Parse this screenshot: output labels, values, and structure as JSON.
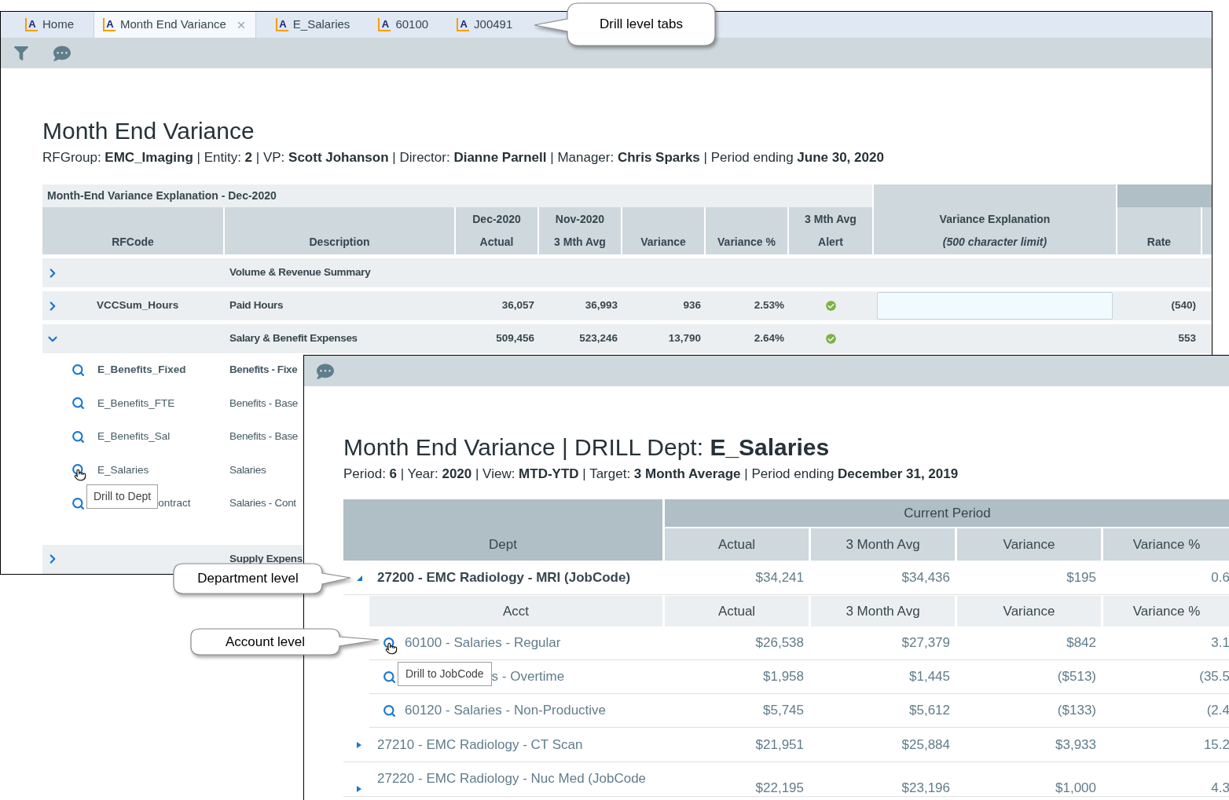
{
  "tabs": [
    {
      "badge": "A",
      "label": "Home",
      "selected": false,
      "closable": false
    },
    {
      "badge": "A",
      "label": "Month End Variance",
      "selected": true,
      "closable": true
    },
    {
      "badge": "A",
      "label": "E_Salaries",
      "selected": false,
      "closable": false
    },
    {
      "badge": "A",
      "label": "60100",
      "selected": false,
      "closable": false
    },
    {
      "badge": "A",
      "label": "J00491",
      "selected": false,
      "closable": false
    }
  ],
  "report": {
    "title": "Month End Variance",
    "subtitle": "RFGroup: **EMC_Imaging** | Entity: **2** | VP: **Scott Johanson** | Director: **Dianne Parnell** | Manager: **Chris Sparks** | Period ending **June 30, 2020**",
    "table": {
      "caption": "Month-End Variance Explanation - Dec-2020",
      "columns": [
        {
          "label": "RFCode"
        },
        {
          "label": "Description"
        },
        {
          "top": "Dec-2020",
          "label": "Actual"
        },
        {
          "top": "Nov-2020",
          "label": "3 Mth Avg"
        },
        {
          "label": "Variance"
        },
        {
          "label": "Variance %"
        },
        {
          "top": "3 Mth Avg",
          "label": "Alert"
        },
        {
          "top": "Variance Explanation",
          "note": "(500 character limit)"
        },
        {
          "label": "Rate"
        }
      ],
      "rows": [
        {
          "kind": "section",
          "expanded": false,
          "description": "Volume & Revenue Summary",
          "alert_ok": false,
          "explanation_field": false
        },
        {
          "kind": "section",
          "expanded": false,
          "code": "VCCSum_Hours",
          "description": "Paid Hours",
          "actual": "36,057",
          "avg": "36,993",
          "variance": "936",
          "variance_pct": "2.53%",
          "alert_ok": true,
          "explanation_field": true,
          "rate": "(540)"
        },
        {
          "kind": "section",
          "expanded": true,
          "description": "Salary & Benefit Expenses",
          "actual": "509,456",
          "avg": "523,246",
          "variance": "13,790",
          "variance_pct": "2.64%",
          "alert_ok": true,
          "explanation_field": false,
          "rate": "553"
        },
        {
          "kind": "detail",
          "code": "E_Benefits_Fixed",
          "description": "Benefits - Fixe",
          "emphasized": true,
          "hovered": false
        },
        {
          "kind": "detail",
          "code": "E_Benefits_FTE",
          "description": "Benefits - Base",
          "emphasized": false,
          "hovered": false
        },
        {
          "kind": "detail",
          "code": "E_Benefits_Sal",
          "description": "Benefits - Base",
          "emphasized": false,
          "hovered": false
        },
        {
          "kind": "detail",
          "code": "E_Salaries",
          "description": "Salaries",
          "emphasized": false,
          "hovered": true
        },
        {
          "kind": "detail",
          "code": "ontract",
          "description": "Salaries - Cont",
          "emphasized": false,
          "hovered": false,
          "tooltip": "Drill to Dept"
        },
        {
          "kind": "section",
          "expanded": false,
          "description": "Supply Expens",
          "alert_ok": false,
          "explanation_field": false
        }
      ]
    }
  },
  "drill": {
    "title": "Month End Variance | DRILL Dept: **E_Salaries**",
    "subtitle": "Period: **6** | Year: **2020** | View: **MTD-YTD** | Target: **3 Month Average** | Period ending **December 31, 2019**",
    "table": {
      "group": "Current Period",
      "columns": [
        "Dept",
        "Actual",
        "3 Month Avg",
        "Variance",
        "Variance %"
      ],
      "rows": [
        {
          "kind": "dept",
          "expanded": true,
          "label": "27200 - EMC Radiology - MRI (JobCode)",
          "values": [
            "$34,241",
            "$34,436",
            "$195",
            "0.6"
          ]
        },
        {
          "kind": "acct_header",
          "columns": [
            "Acct",
            "Actual",
            "3 Month Avg",
            "Variance",
            "Variance %"
          ]
        },
        {
          "kind": "acct",
          "label": "60100 - Salaries - Regular",
          "hovered": true,
          "values": [
            "$26,538",
            "$27,379",
            "$842",
            "3.1"
          ]
        },
        {
          "kind": "acct",
          "label": "s - Overtime",
          "hovered": false,
          "tooltip": "Drill to JobCode",
          "values": [
            "$1,958",
            "$1,445",
            "($513)",
            "(35.5"
          ]
        },
        {
          "kind": "acct",
          "label": "60120 - Salaries - Non-Productive",
          "hovered": false,
          "values": [
            "$5,745",
            "$5,612",
            "($133)",
            "(2.4"
          ]
        },
        {
          "kind": "dept",
          "expanded": false,
          "label": "27210 - EMC Radiology - CT Scan",
          "values": [
            "$21,951",
            "$25,884",
            "$3,933",
            "15.2"
          ]
        },
        {
          "kind": "dept",
          "expanded": false,
          "label": "27220 - EMC Radiology - Nuc Med (JobCode",
          "values": [
            "$22,195",
            "$23,196",
            "$1,000",
            "4.3"
          ]
        }
      ]
    }
  },
  "callouts": [
    {
      "text": "Drill level tabs"
    },
    {
      "text": "Department level"
    },
    {
      "text": "Account level"
    }
  ]
}
